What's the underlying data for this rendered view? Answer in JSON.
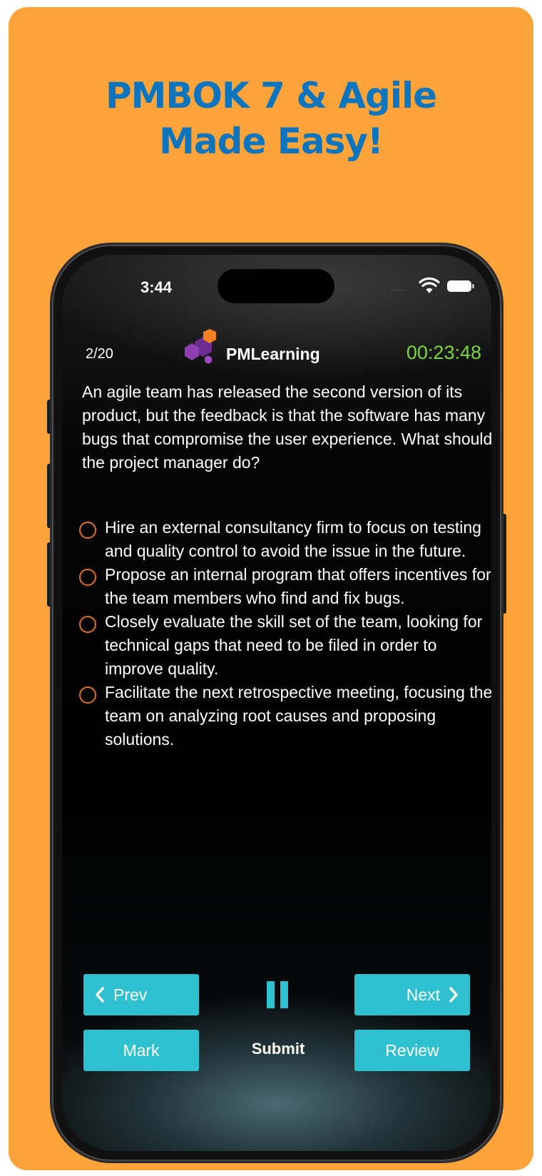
{
  "headline": {
    "line1": "PMBOK 7 & Agile",
    "line2": "Made Easy!"
  },
  "status_bar": {
    "time": "3:44",
    "signal_dots": "....."
  },
  "header": {
    "counter": "2/20",
    "brand_name": "PMLearning",
    "timer": "00:23:48"
  },
  "question": "An agile team has released the second version of its product, but the feedback is that the software has many bugs that compromise the user experience. What should the project manager do?",
  "options": [
    "Hire an external consultancy firm to focus on testing and quality control to avoid the issue in the future.",
    "Propose an internal program that offers incentives for the team members who find and fix bugs.",
    "Closely evaluate the skill set of the team, looking for technical gaps that need to be filed in order to improve quality.",
    "Facilitate the next retrospective meeting, focusing the team on analyzing root causes and proposing solutions."
  ],
  "controls": {
    "prev_label": "Prev",
    "next_label": "Next",
    "mark_label": "Mark",
    "submit_label": "Submit",
    "review_label": "Review"
  },
  "colors": {
    "background": "#FCA43A",
    "headline": "#0D74BE",
    "button": "#2EC0CF",
    "timer": "#7BD63B",
    "radio": "#E2711D"
  },
  "icons": [
    "pmlearning-logo-icon",
    "wifi-icon",
    "battery-icon",
    "chevron-left-icon",
    "chevron-right-icon",
    "pause-icon"
  ]
}
